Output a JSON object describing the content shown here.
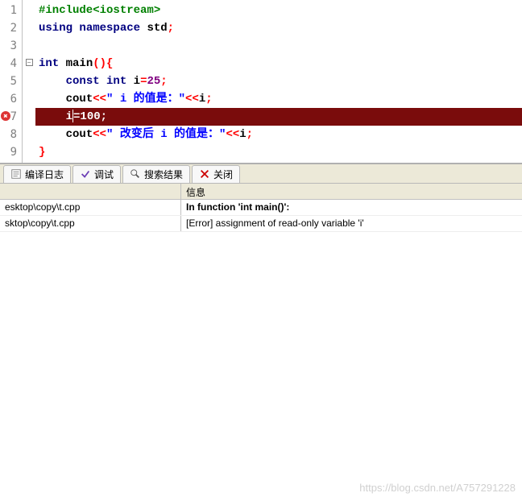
{
  "editor": {
    "lines": [
      {
        "n": 1,
        "fold": "",
        "tokens": [
          {
            "cls": "tok-pp",
            "t": "#include<iostream>"
          }
        ]
      },
      {
        "n": 2,
        "fold": "",
        "tokens": [
          {
            "cls": "tok-kw",
            "t": "using"
          },
          {
            "cls": "",
            "t": " "
          },
          {
            "cls": "tok-kw",
            "t": "namespace"
          },
          {
            "cls": "",
            "t": " "
          },
          {
            "cls": "tok-id",
            "t": "std"
          },
          {
            "cls": "tok-punc",
            "t": ";"
          }
        ]
      },
      {
        "n": 3,
        "fold": "",
        "tokens": []
      },
      {
        "n": 4,
        "fold": "minus",
        "tokens": [
          {
            "cls": "tok-type",
            "t": "int"
          },
          {
            "cls": "",
            "t": " "
          },
          {
            "cls": "tok-id",
            "t": "main"
          },
          {
            "cls": "tok-punc",
            "t": "()"
          },
          {
            "cls": "tok-brace",
            "t": "{"
          }
        ]
      },
      {
        "n": 5,
        "fold": "",
        "indent": 1,
        "tokens": [
          {
            "cls": "tok-kw",
            "t": "const"
          },
          {
            "cls": "",
            "t": " "
          },
          {
            "cls": "tok-type",
            "t": "int"
          },
          {
            "cls": "",
            "t": " "
          },
          {
            "cls": "tok-id",
            "t": "i"
          },
          {
            "cls": "tok-op",
            "t": "="
          },
          {
            "cls": "tok-num",
            "t": "25"
          },
          {
            "cls": "tok-punc",
            "t": ";"
          }
        ]
      },
      {
        "n": 6,
        "fold": "",
        "indent": 1,
        "tokens": [
          {
            "cls": "tok-id",
            "t": "cout"
          },
          {
            "cls": "tok-op",
            "t": "<<"
          },
          {
            "cls": "tok-str",
            "t": "\" i 的值是：\""
          },
          {
            "cls": "tok-op",
            "t": "<<"
          },
          {
            "cls": "tok-id",
            "t": "i"
          },
          {
            "cls": "tok-punc",
            "t": ";"
          }
        ]
      },
      {
        "n": 7,
        "fold": "",
        "indent": 1,
        "hl": true,
        "error": true,
        "tokens": [
          {
            "cls": "",
            "t": "i"
          },
          {
            "cls": "caret",
            "t": ""
          },
          {
            "cls": "",
            "t": "=100;"
          }
        ]
      },
      {
        "n": 8,
        "fold": "",
        "indent": 1,
        "tokens": [
          {
            "cls": "tok-id",
            "t": "cout"
          },
          {
            "cls": "tok-op",
            "t": "<<"
          },
          {
            "cls": "tok-str",
            "t": "\" 改变后 i 的值是：\""
          },
          {
            "cls": "tok-op",
            "t": "<<"
          },
          {
            "cls": "tok-id",
            "t": "i"
          },
          {
            "cls": "tok-punc",
            "t": ";"
          }
        ]
      },
      {
        "n": 9,
        "fold": "",
        "tokens": [
          {
            "cls": "tok-brace",
            "t": "}"
          }
        ]
      }
    ]
  },
  "panel": {
    "tabs": {
      "compile_log": "编译日志",
      "debug": "调试",
      "search": "搜索结果",
      "close": "关闭"
    },
    "headers": {
      "file": "",
      "message": "信息"
    },
    "rows": [
      {
        "file": "esktop\\copy\\t.cpp",
        "message": "In function 'int main()':",
        "bold": true
      },
      {
        "file": "sktop\\copy\\t.cpp",
        "message": "[Error] assignment of read-only variable 'i'",
        "bold": false
      }
    ]
  },
  "watermark": "https://blog.csdn.net/A757291228"
}
